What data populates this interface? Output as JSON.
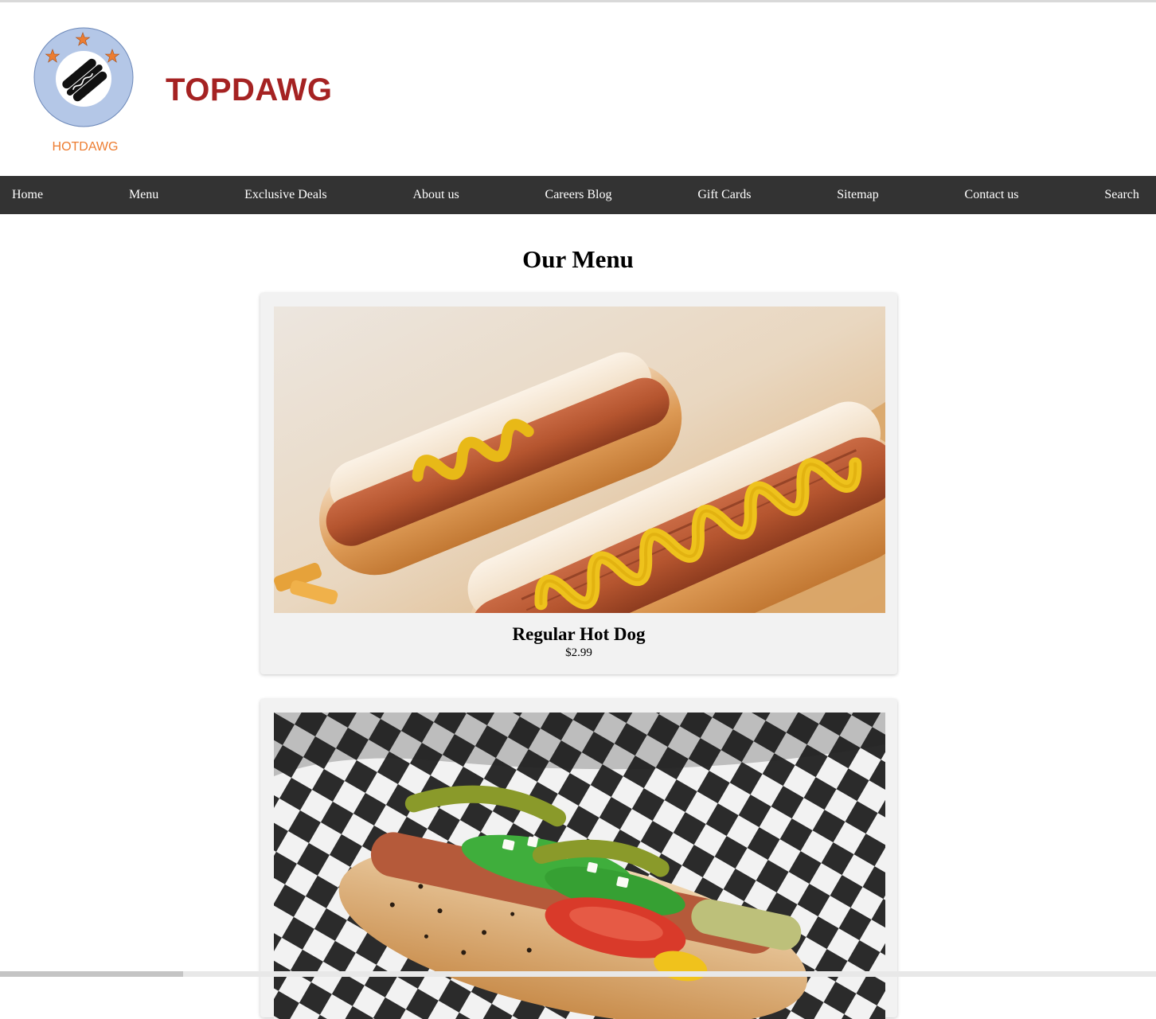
{
  "header": {
    "logo_text": "HOTDAWG",
    "brand_title": "TOPDAWG"
  },
  "nav": {
    "items": [
      {
        "label": "Home"
      },
      {
        "label": "Menu"
      },
      {
        "label": "Exclusive Deals"
      },
      {
        "label": "About us"
      },
      {
        "label": "Careers Blog"
      },
      {
        "label": "Gift Cards"
      },
      {
        "label": "Sitemap"
      },
      {
        "label": "Contact us"
      },
      {
        "label": "Search"
      }
    ]
  },
  "main": {
    "heading": "Our Menu",
    "items": [
      {
        "name": "Regular Hot Dog",
        "price": "$2.99",
        "image": "hot-dog-with-mustard-photo"
      },
      {
        "image": "chicago-style-hot-dog-photo"
      }
    ]
  },
  "colors": {
    "brand_red": "#a52222",
    "nav_bg": "#333333",
    "card_bg": "#f2f2f2",
    "logo_ring": "#b4c7e7",
    "logo_star": "#ed7d31"
  },
  "icons": [
    "hotdog-logo-icon",
    "star-icon"
  ]
}
